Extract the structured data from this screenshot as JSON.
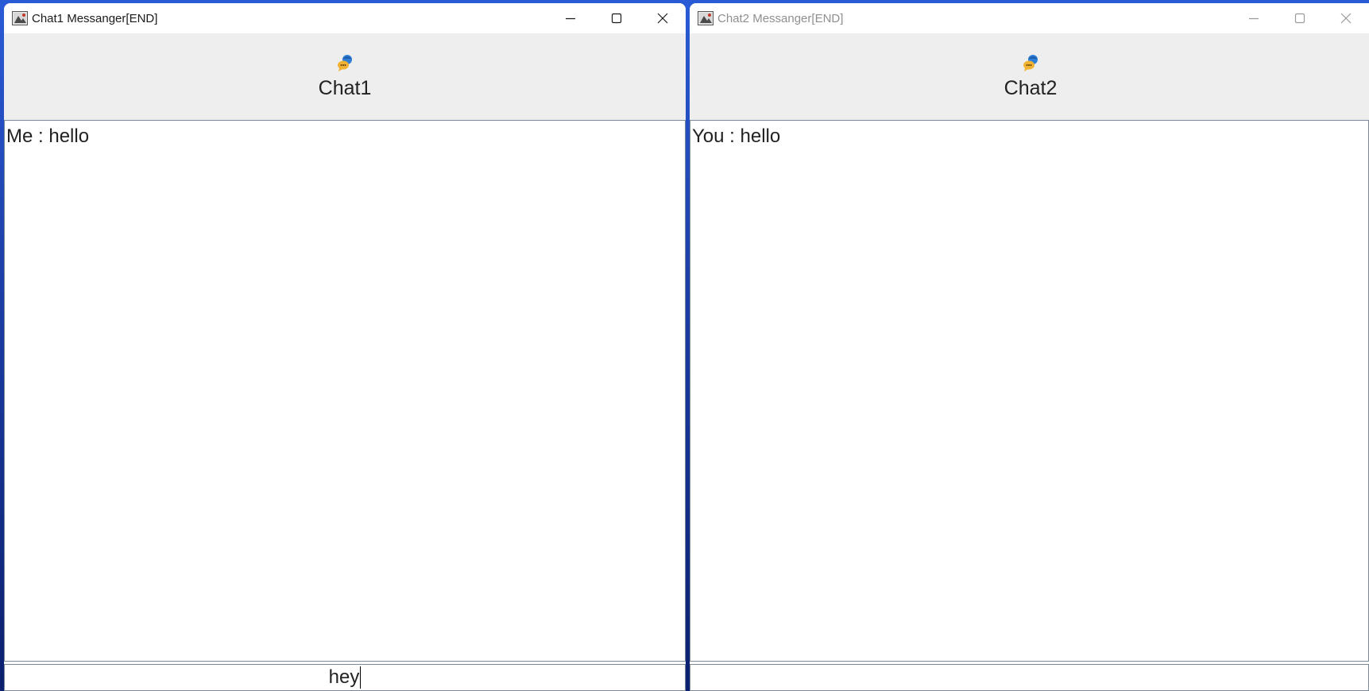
{
  "windows": [
    {
      "title": "Chat1 Messanger[END]",
      "active": true,
      "header_title": "Chat1",
      "messages": [
        "Me : hello"
      ],
      "input_value": "hey"
    },
    {
      "title": "Chat2 Messanger[END]",
      "active": false,
      "header_title": "Chat2",
      "messages": [
        "You : hello"
      ],
      "input_value": ""
    }
  ],
  "icons": {
    "app": "java-app-icon",
    "chat": "chat-bubble-person-icon",
    "minimize": "minimize-icon",
    "maximize": "maximize-icon",
    "close": "close-icon"
  },
  "colors": {
    "header_background": "#eeeeee",
    "panel_border": "#7a8a99",
    "inactive_title": "#8f8f8f",
    "desktop_accent": "#1d3fa8"
  }
}
